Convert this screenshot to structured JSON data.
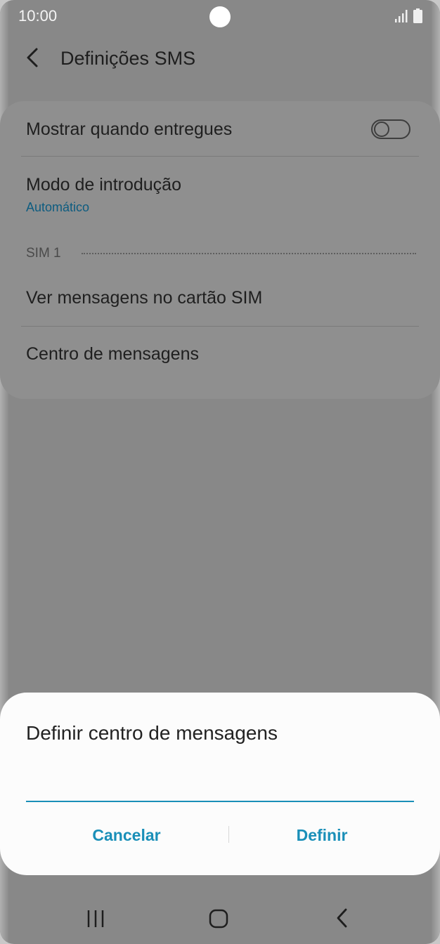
{
  "status_bar": {
    "time": "10:00",
    "icons": [
      "signal-icon",
      "battery-icon"
    ]
  },
  "header": {
    "title": "Definições SMS",
    "back_icon": "back-arrow-icon"
  },
  "settings": {
    "show_delivered": {
      "label": "Mostrar quando entregues",
      "toggle_on": false
    },
    "input_mode": {
      "label": "Modo de introdução",
      "value": "Automático"
    },
    "section_header": "SIM 1",
    "view_sim_messages": {
      "label": "Ver mensagens no cartão SIM"
    },
    "message_center": {
      "label": "Centro de mensagens"
    }
  },
  "dialog": {
    "title": "Definir centro de mensagens",
    "input_value": "",
    "cancel_label": "Cancelar",
    "define_label": "Definir"
  },
  "nav_bar": {
    "icons": [
      "recents-icon",
      "home-icon",
      "back-icon"
    ]
  },
  "colors": {
    "accent": "#1a8fb8",
    "dim_background": "#888888",
    "sub_text": "#0d5c80",
    "dialog_background": "#fcfcfc"
  }
}
